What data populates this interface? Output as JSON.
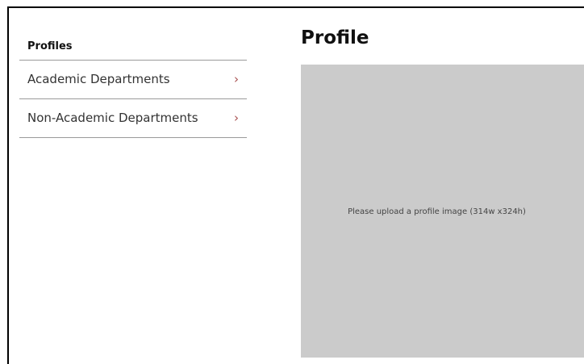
{
  "sidebar": {
    "heading": "Profiles",
    "items": [
      {
        "label": "Academic Departments",
        "chevron": "›"
      },
      {
        "label": "Non-Academic Departments",
        "chevron": "›"
      }
    ]
  },
  "main": {
    "title": "Profile",
    "image_placeholder": "Please upload a profile image (314w x324h)"
  },
  "colors": {
    "chevron": "#a85050",
    "placeholder_bg": "#cbcbcb",
    "divider": "#9a9a9a"
  }
}
